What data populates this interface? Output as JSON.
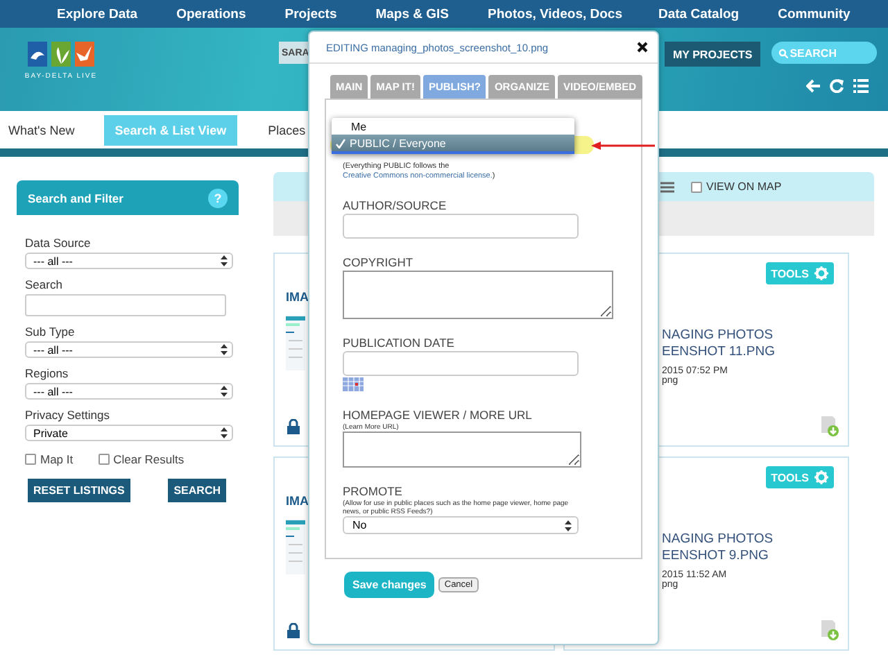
{
  "nav": {
    "items": [
      "Explore Data",
      "Operations",
      "Projects",
      "Maps & GIS",
      "Photos, Videos, Docs",
      "Data Catalog",
      "Community"
    ]
  },
  "banner": {
    "logo_text": "BAY-DELTA LIVE",
    "user_button": "SARA",
    "projects_button": "MY PROJECTS",
    "search": {
      "placeholder": "SEARCH"
    }
  },
  "subnav": [
    {
      "label": "What's New",
      "selected": false
    },
    {
      "label": "Search & List View",
      "selected": true
    },
    {
      "label": "Places",
      "selected": false
    }
  ],
  "sidebar": {
    "title": "Search and Filter",
    "help": "?",
    "fields": [
      {
        "kind": "select",
        "label": "Data Source",
        "value": "--- all ---"
      },
      {
        "kind": "text",
        "label": "Search"
      },
      {
        "kind": "select",
        "label": "Sub Type",
        "value": "--- all ---"
      },
      {
        "kind": "select",
        "label": "Regions",
        "value": "--- all ---"
      },
      {
        "kind": "select",
        "label": "Privacy Settings",
        "value": "Private"
      }
    ],
    "checkboxes": [
      {
        "label": "Map It",
        "checked": false
      },
      {
        "label": "Clear Results",
        "checked": false
      }
    ],
    "buttons": [
      "RESET LISTINGS",
      "SEARCH"
    ]
  },
  "toolbar": {
    "view_on_map": {
      "label": "VIEW ON MAP",
      "checked": false
    }
  },
  "results": [
    {
      "left": {
        "title": "IMA"
      },
      "right": {
        "tools": "TOOLS",
        "name_lines": [
          "NAGING PHOTOS",
          "EENSHOT 11.PNG"
        ],
        "date": "2015 07:52 PM",
        "type": "png"
      }
    },
    {
      "left": {
        "title": "IMA"
      },
      "right": {
        "tools": "TOOLS",
        "name_lines": [
          "NAGING PHOTOS",
          "EENSHOT 9.PNG"
        ],
        "date": "2015 11:52 AM",
        "type": "png"
      }
    }
  ],
  "modal": {
    "title": "EDITING managing_photos_screenshot_10.png",
    "tabs": [
      {
        "label": "MAIN",
        "selected": false
      },
      {
        "label": "MAP IT!",
        "selected": false
      },
      {
        "label": "PUBLISH?",
        "selected": true
      },
      {
        "label": "ORGANIZE",
        "selected": false
      },
      {
        "label": "VIDEO/EMBED",
        "selected": false
      }
    ],
    "access_options": [
      {
        "label": "Me",
        "selected": false
      },
      {
        "label": "PUBLIC / Everyone",
        "selected": true
      }
    ],
    "note": {
      "before": "(Everything PUBLIC follows the ",
      "link": "Creative Commons non-commercial license.",
      "after": ")"
    },
    "fields": [
      {
        "kind": "input",
        "label": "AUTHOR/SOURCE"
      },
      {
        "kind": "textarea",
        "label": "COPYRIGHT"
      },
      {
        "kind": "date",
        "label": "PUBLICATION DATE"
      },
      {
        "kind": "textarea",
        "label": "HOMEPAGE VIEWER / MORE URL",
        "hint": "(Learn More URL)"
      },
      {
        "kind": "select",
        "label": "PROMOTE",
        "hint": "(Allow for use in public places such as the home page viewer, home page news, or public RSS Feeds?)",
        "value": "No"
      }
    ],
    "save": "Save changes",
    "cancel": "Cancel"
  }
}
